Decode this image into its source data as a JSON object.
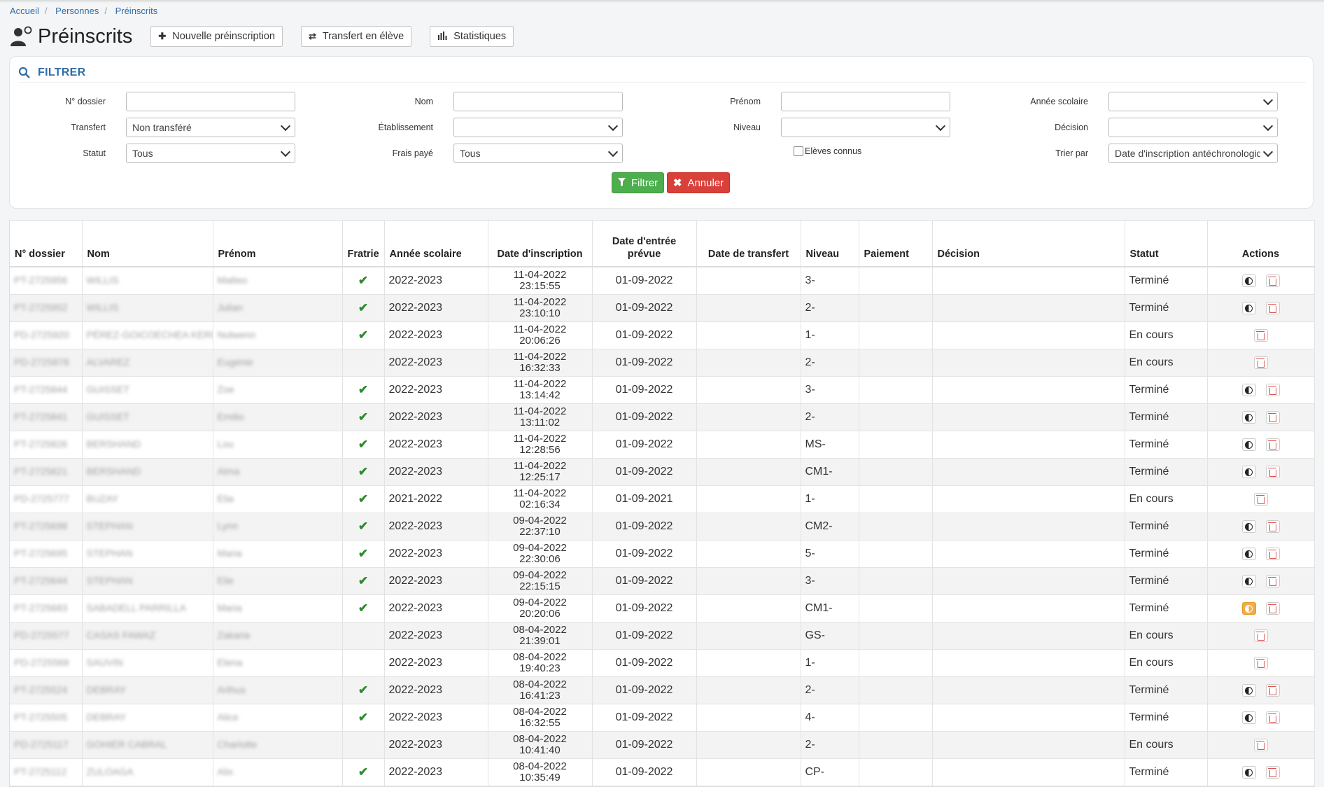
{
  "breadcrumb": [
    "Accueil",
    "Personnes",
    "Préinscrits"
  ],
  "page": {
    "title": "Préinscrits",
    "buttons": {
      "new": "Nouvelle préinscription",
      "transfer": "Transfert en élève",
      "stats": "Statistiques"
    }
  },
  "filter": {
    "title": "FILTRER",
    "labels": {
      "dossier": "N° dossier",
      "nom": "Nom",
      "prenom": "Prénom",
      "annee": "Année scolaire",
      "transfert": "Transfert",
      "etablissement": "Établissement",
      "niveau": "Niveau",
      "decision": "Décision",
      "statut": "Statut",
      "frais": "Frais payé",
      "eleves_connus": "Elèves connus",
      "trier": "Trier par"
    },
    "values": {
      "transfert": "Non transféré",
      "statut": "Tous",
      "frais": "Tous",
      "trier": "Date d'inscription antéchronologique"
    },
    "filtrer_label": "Filtrer",
    "annuler_label": "Annuler"
  },
  "table": {
    "headers": [
      "N° dossier",
      "Nom",
      "Prénom",
      "Fratrie",
      "Année scolaire",
      "Date d'inscription",
      "Date d'entrée prévue",
      "Date de transfert",
      "Niveau",
      "Paiement",
      "Décision",
      "Statut",
      "Actions"
    ],
    "rows": [
      {
        "dossier": "PT-2725956",
        "nom": "WILLIS",
        "prenom": "Matteo",
        "fratrie": true,
        "annee": "2022-2023",
        "date_insc": "11-04-2022",
        "heure_insc": "23:15:55",
        "entree": "01-09-2022",
        "niveau": "3-",
        "statut": "Terminé",
        "contrast": true,
        "warn": false
      },
      {
        "dossier": "PT-2725952",
        "nom": "WILLIS",
        "prenom": "Julian",
        "fratrie": true,
        "annee": "2022-2023",
        "date_insc": "11-04-2022",
        "heure_insc": "23:10:10",
        "entree": "01-09-2022",
        "niveau": "2-",
        "statut": "Terminé",
        "contrast": true,
        "warn": false
      },
      {
        "dossier": "PD-2725920",
        "nom": "PÉREZ-GOICOECHEA KERGALL",
        "prenom": "Nolwenn",
        "fratrie": true,
        "annee": "2022-2023",
        "date_insc": "11-04-2022",
        "heure_insc": "20:06:26",
        "entree": "01-09-2022",
        "niveau": "1-",
        "statut": "En cours",
        "contrast": false,
        "warn": false
      },
      {
        "dossier": "PD-2725878",
        "nom": "ALVAREZ",
        "prenom": "Eugénie",
        "fratrie": false,
        "annee": "2022-2023",
        "date_insc": "11-04-2022",
        "heure_insc": "16:32:33",
        "entree": "01-09-2022",
        "niveau": "2-",
        "statut": "En cours",
        "contrast": false,
        "warn": false
      },
      {
        "dossier": "PT-2725844",
        "nom": "GUISSET",
        "prenom": "Zoe",
        "fratrie": true,
        "annee": "2022-2023",
        "date_insc": "11-04-2022",
        "heure_insc": "13:14:42",
        "entree": "01-09-2022",
        "niveau": "3-",
        "statut": "Terminé",
        "contrast": true,
        "warn": false
      },
      {
        "dossier": "PT-2725841",
        "nom": "GUISSET",
        "prenom": "Emilio",
        "fratrie": true,
        "annee": "2022-2023",
        "date_insc": "11-04-2022",
        "heure_insc": "13:11:02",
        "entree": "01-09-2022",
        "niveau": "2-",
        "statut": "Terminé",
        "contrast": true,
        "warn": false
      },
      {
        "dossier": "PT-2725826",
        "nom": "BERSHAND",
        "prenom": "Lou",
        "fratrie": true,
        "annee": "2022-2023",
        "date_insc": "11-04-2022",
        "heure_insc": "12:28:56",
        "entree": "01-09-2022",
        "niveau": "MS-",
        "statut": "Terminé",
        "contrast": true,
        "warn": false
      },
      {
        "dossier": "PT-2725821",
        "nom": "BERSHAND",
        "prenom": "Alma",
        "fratrie": true,
        "annee": "2022-2023",
        "date_insc": "11-04-2022",
        "heure_insc": "12:25:17",
        "entree": "01-09-2022",
        "niveau": "CM1-",
        "statut": "Terminé",
        "contrast": true,
        "warn": false
      },
      {
        "dossier": "PD-2725777",
        "nom": "BUZAY",
        "prenom": "Elia",
        "fratrie": true,
        "annee": "2021-2022",
        "date_insc": "11-04-2022",
        "heure_insc": "02:16:34",
        "entree": "01-09-2021",
        "niveau": "1-",
        "statut": "En cours",
        "contrast": false,
        "warn": false
      },
      {
        "dossier": "PT-2725698",
        "nom": "STEPHAN",
        "prenom": "Lynn",
        "fratrie": true,
        "annee": "2022-2023",
        "date_insc": "09-04-2022",
        "heure_insc": "22:37:10",
        "entree": "01-09-2022",
        "niveau": "CM2-",
        "statut": "Terminé",
        "contrast": true,
        "warn": false
      },
      {
        "dossier": "PT-2725695",
        "nom": "STEPHAN",
        "prenom": "Maria",
        "fratrie": true,
        "annee": "2022-2023",
        "date_insc": "09-04-2022",
        "heure_insc": "22:30:06",
        "entree": "01-09-2022",
        "niveau": "5-",
        "statut": "Terminé",
        "contrast": true,
        "warn": false
      },
      {
        "dossier": "PT-2725644",
        "nom": "STEPHAN",
        "prenom": "Elie",
        "fratrie": true,
        "annee": "2022-2023",
        "date_insc": "09-04-2022",
        "heure_insc": "22:15:15",
        "entree": "01-09-2022",
        "niveau": "3-",
        "statut": "Terminé",
        "contrast": true,
        "warn": false
      },
      {
        "dossier": "PT-2725683",
        "nom": "SABADELL PARRILLA",
        "prenom": "Maria",
        "fratrie": true,
        "annee": "2022-2023",
        "date_insc": "09-04-2022",
        "heure_insc": "20:20:06",
        "entree": "01-09-2022",
        "niveau": "CM1-",
        "statut": "Terminé",
        "contrast": true,
        "warn": true
      },
      {
        "dossier": "PD-2725577",
        "nom": "CASAS FAWAZ",
        "prenom": "Zakaria",
        "fratrie": false,
        "annee": "2022-2023",
        "date_insc": "08-04-2022",
        "heure_insc": "21:39:01",
        "entree": "01-09-2022",
        "niveau": "GS-",
        "statut": "En cours",
        "contrast": false,
        "warn": false
      },
      {
        "dossier": "PD-2725568",
        "nom": "SAUVIN",
        "prenom": "Elena",
        "fratrie": false,
        "annee": "2022-2023",
        "date_insc": "08-04-2022",
        "heure_insc": "19:40:23",
        "entree": "01-09-2022",
        "niveau": "1-",
        "statut": "En cours",
        "contrast": false,
        "warn": false
      },
      {
        "dossier": "PT-2725524",
        "nom": "DEBRAY",
        "prenom": "Arthus",
        "fratrie": true,
        "annee": "2022-2023",
        "date_insc": "08-04-2022",
        "heure_insc": "16:41:23",
        "entree": "01-09-2022",
        "niveau": "2-",
        "statut": "Terminé",
        "contrast": true,
        "warn": false
      },
      {
        "dossier": "PT-2725505",
        "nom": "DEBRAY",
        "prenom": "Alice",
        "fratrie": true,
        "annee": "2022-2023",
        "date_insc": "08-04-2022",
        "heure_insc": "16:32:55",
        "entree": "01-09-2022",
        "niveau": "4-",
        "statut": "Terminé",
        "contrast": true,
        "warn": false
      },
      {
        "dossier": "PD-2725117",
        "nom": "GOHIER CABRAL",
        "prenom": "Charlotte",
        "fratrie": false,
        "annee": "2022-2023",
        "date_insc": "08-04-2022",
        "heure_insc": "10:41:40",
        "entree": "01-09-2022",
        "niveau": "2-",
        "statut": "En cours",
        "contrast": false,
        "warn": false
      },
      {
        "dossier": "PT-2725112",
        "nom": "ZULOAGA",
        "prenom": "Alix",
        "fratrie": true,
        "annee": "2022-2023",
        "date_insc": "08-04-2022",
        "heure_insc": "10:35:49",
        "entree": "01-09-2022",
        "niveau": "CP-",
        "statut": "Terminé",
        "contrast": true,
        "warn": false
      }
    ]
  },
  "colors": {
    "link": "#2f6ea8",
    "check": "#2e8a2e",
    "success": "#4cae4c",
    "danger": "#d9403a",
    "warning": "#f0ad4e"
  },
  "icons": {
    "page": "user-plus-icon",
    "new": "plus-icon",
    "transfer": "exchange-icon",
    "stats": "bar-chart-icon",
    "filter": "search-icon",
    "fratrie": "check-icon",
    "action_1": "contrast-icon",
    "action_2": "trash-icon"
  }
}
